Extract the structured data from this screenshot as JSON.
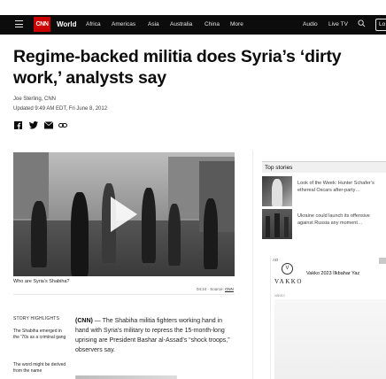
{
  "nav": {
    "logo": "CNN",
    "section": "World",
    "links": [
      "Africa",
      "Americas",
      "Asia",
      "Australia",
      "China",
      "More"
    ],
    "right_links": [
      "Audio",
      "Live TV"
    ],
    "login": "Lo"
  },
  "article": {
    "headline": "Regime-backed militia does Syria’s ‘dirty work,’ analysts say",
    "byline": "Joe Sterling, CNN",
    "updated": "Updated 9:49 AM EDT, Fri June 8, 2012",
    "share_icons": [
      "facebook-icon",
      "twitter-icon",
      "email-icon",
      "link-icon"
    ],
    "video": {
      "caption": "Who are Syria’s Shabiha?",
      "duration": "04:24",
      "source_label": "Source:",
      "source": "CNN"
    },
    "highlights": {
      "title": "STORY HIGHLIGHTS",
      "items": [
        "The Shabiha emerged in the '70s as a criminal gang",
        "The word might be derived from the name"
      ]
    },
    "body": {
      "dateline": "(CNN)",
      "text": " — The Shabiha militia fighters working hand in hand with Syria’s military to repress the 15-month-long uprising are President Bashar al-Assad’s “shock troops,” observers say."
    }
  },
  "rail": {
    "top_stories_title": "Top stories",
    "stories": [
      {
        "text": "Look of the Week: Hunter Schafer’s ethereal Oscars after-party…"
      },
      {
        "text": "Ukraine could launch its offensive against Russia any moment…"
      }
    ],
    "ad": {
      "label": "AD",
      "logo_mark": "V",
      "brand": "VAKKO",
      "headline": "Vakko 2023 İlkbahar Yaz",
      "sub": "VAKKO"
    }
  },
  "colors": {
    "nav_bg": "#0c0c0c",
    "logo_red": "#cc0000",
    "text": "#0c0c0c"
  }
}
